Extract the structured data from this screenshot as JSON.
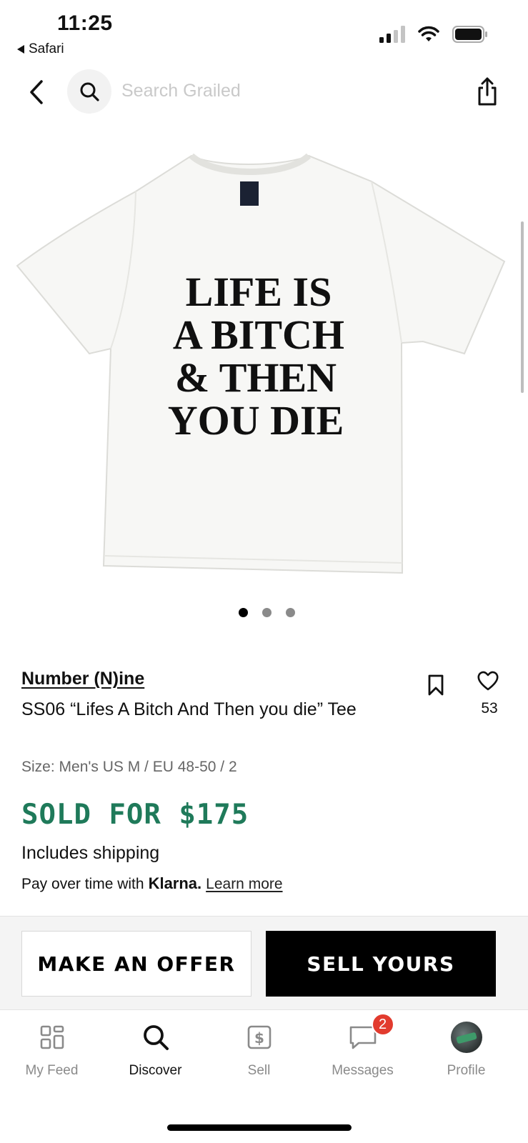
{
  "status_bar": {
    "time": "11:25",
    "back_app": "Safari",
    "icons": [
      "signal-icon",
      "wifi-icon",
      "battery-icon"
    ]
  },
  "nav": {
    "search_placeholder": "Search Grailed",
    "icons": [
      "back-chevron-icon",
      "search-icon",
      "share-icon"
    ]
  },
  "product_image": {
    "print_lines": [
      "LIFE IS",
      "A BITCH",
      "& THEN",
      "YOU DIE"
    ],
    "carousel": {
      "count": 3,
      "active_index": 0
    }
  },
  "product": {
    "designer": "Number (N)ine",
    "title": "SS06 “Lifes A Bitch And Then you die” Tee",
    "likes": "53",
    "size": "Size: Men's US M / EU 48-50 / 2",
    "sold_label": "SOLD FOR $175",
    "shipping": "Includes shipping",
    "klarna_prefix": "Pay over time with",
    "klarna_brand": "Klarna.",
    "klarna_link": "Learn more"
  },
  "actions": {
    "offer_label": "MAKE AN OFFER",
    "sell_label": "SELL YOURS"
  },
  "tabbar": {
    "items": [
      {
        "label": "My Feed",
        "icon": "feed-grid-icon"
      },
      {
        "label": "Discover",
        "icon": "search-icon"
      },
      {
        "label": "Sell",
        "icon": "sell-dollar-icon"
      },
      {
        "label": "Messages",
        "icon": "message-bubble-icon",
        "badge": "2"
      },
      {
        "label": "Profile",
        "icon": "avatar"
      }
    ],
    "active": "Discover"
  },
  "colors": {
    "sold_green": "#1f7a5a",
    "badge_red": "#e23b2e",
    "placeholder_gray": "#c9c9c9"
  }
}
